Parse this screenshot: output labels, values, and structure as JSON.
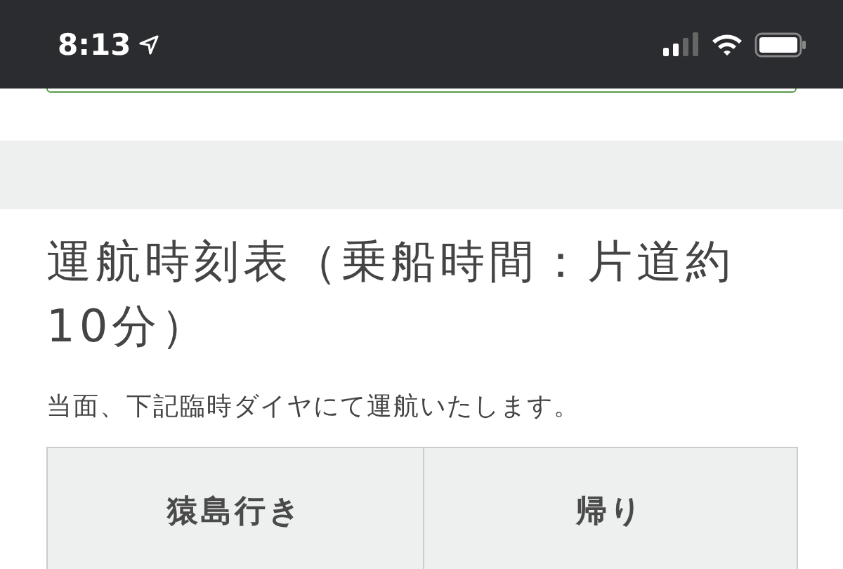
{
  "status_bar": {
    "time": "8:13"
  },
  "section": {
    "title": "運航時刻表（乗船時間：片道約10分）",
    "note": "当面、下記臨時ダイヤにて運航いたします。"
  },
  "table": {
    "columns": [
      "猿島行き",
      "帰り"
    ]
  }
}
